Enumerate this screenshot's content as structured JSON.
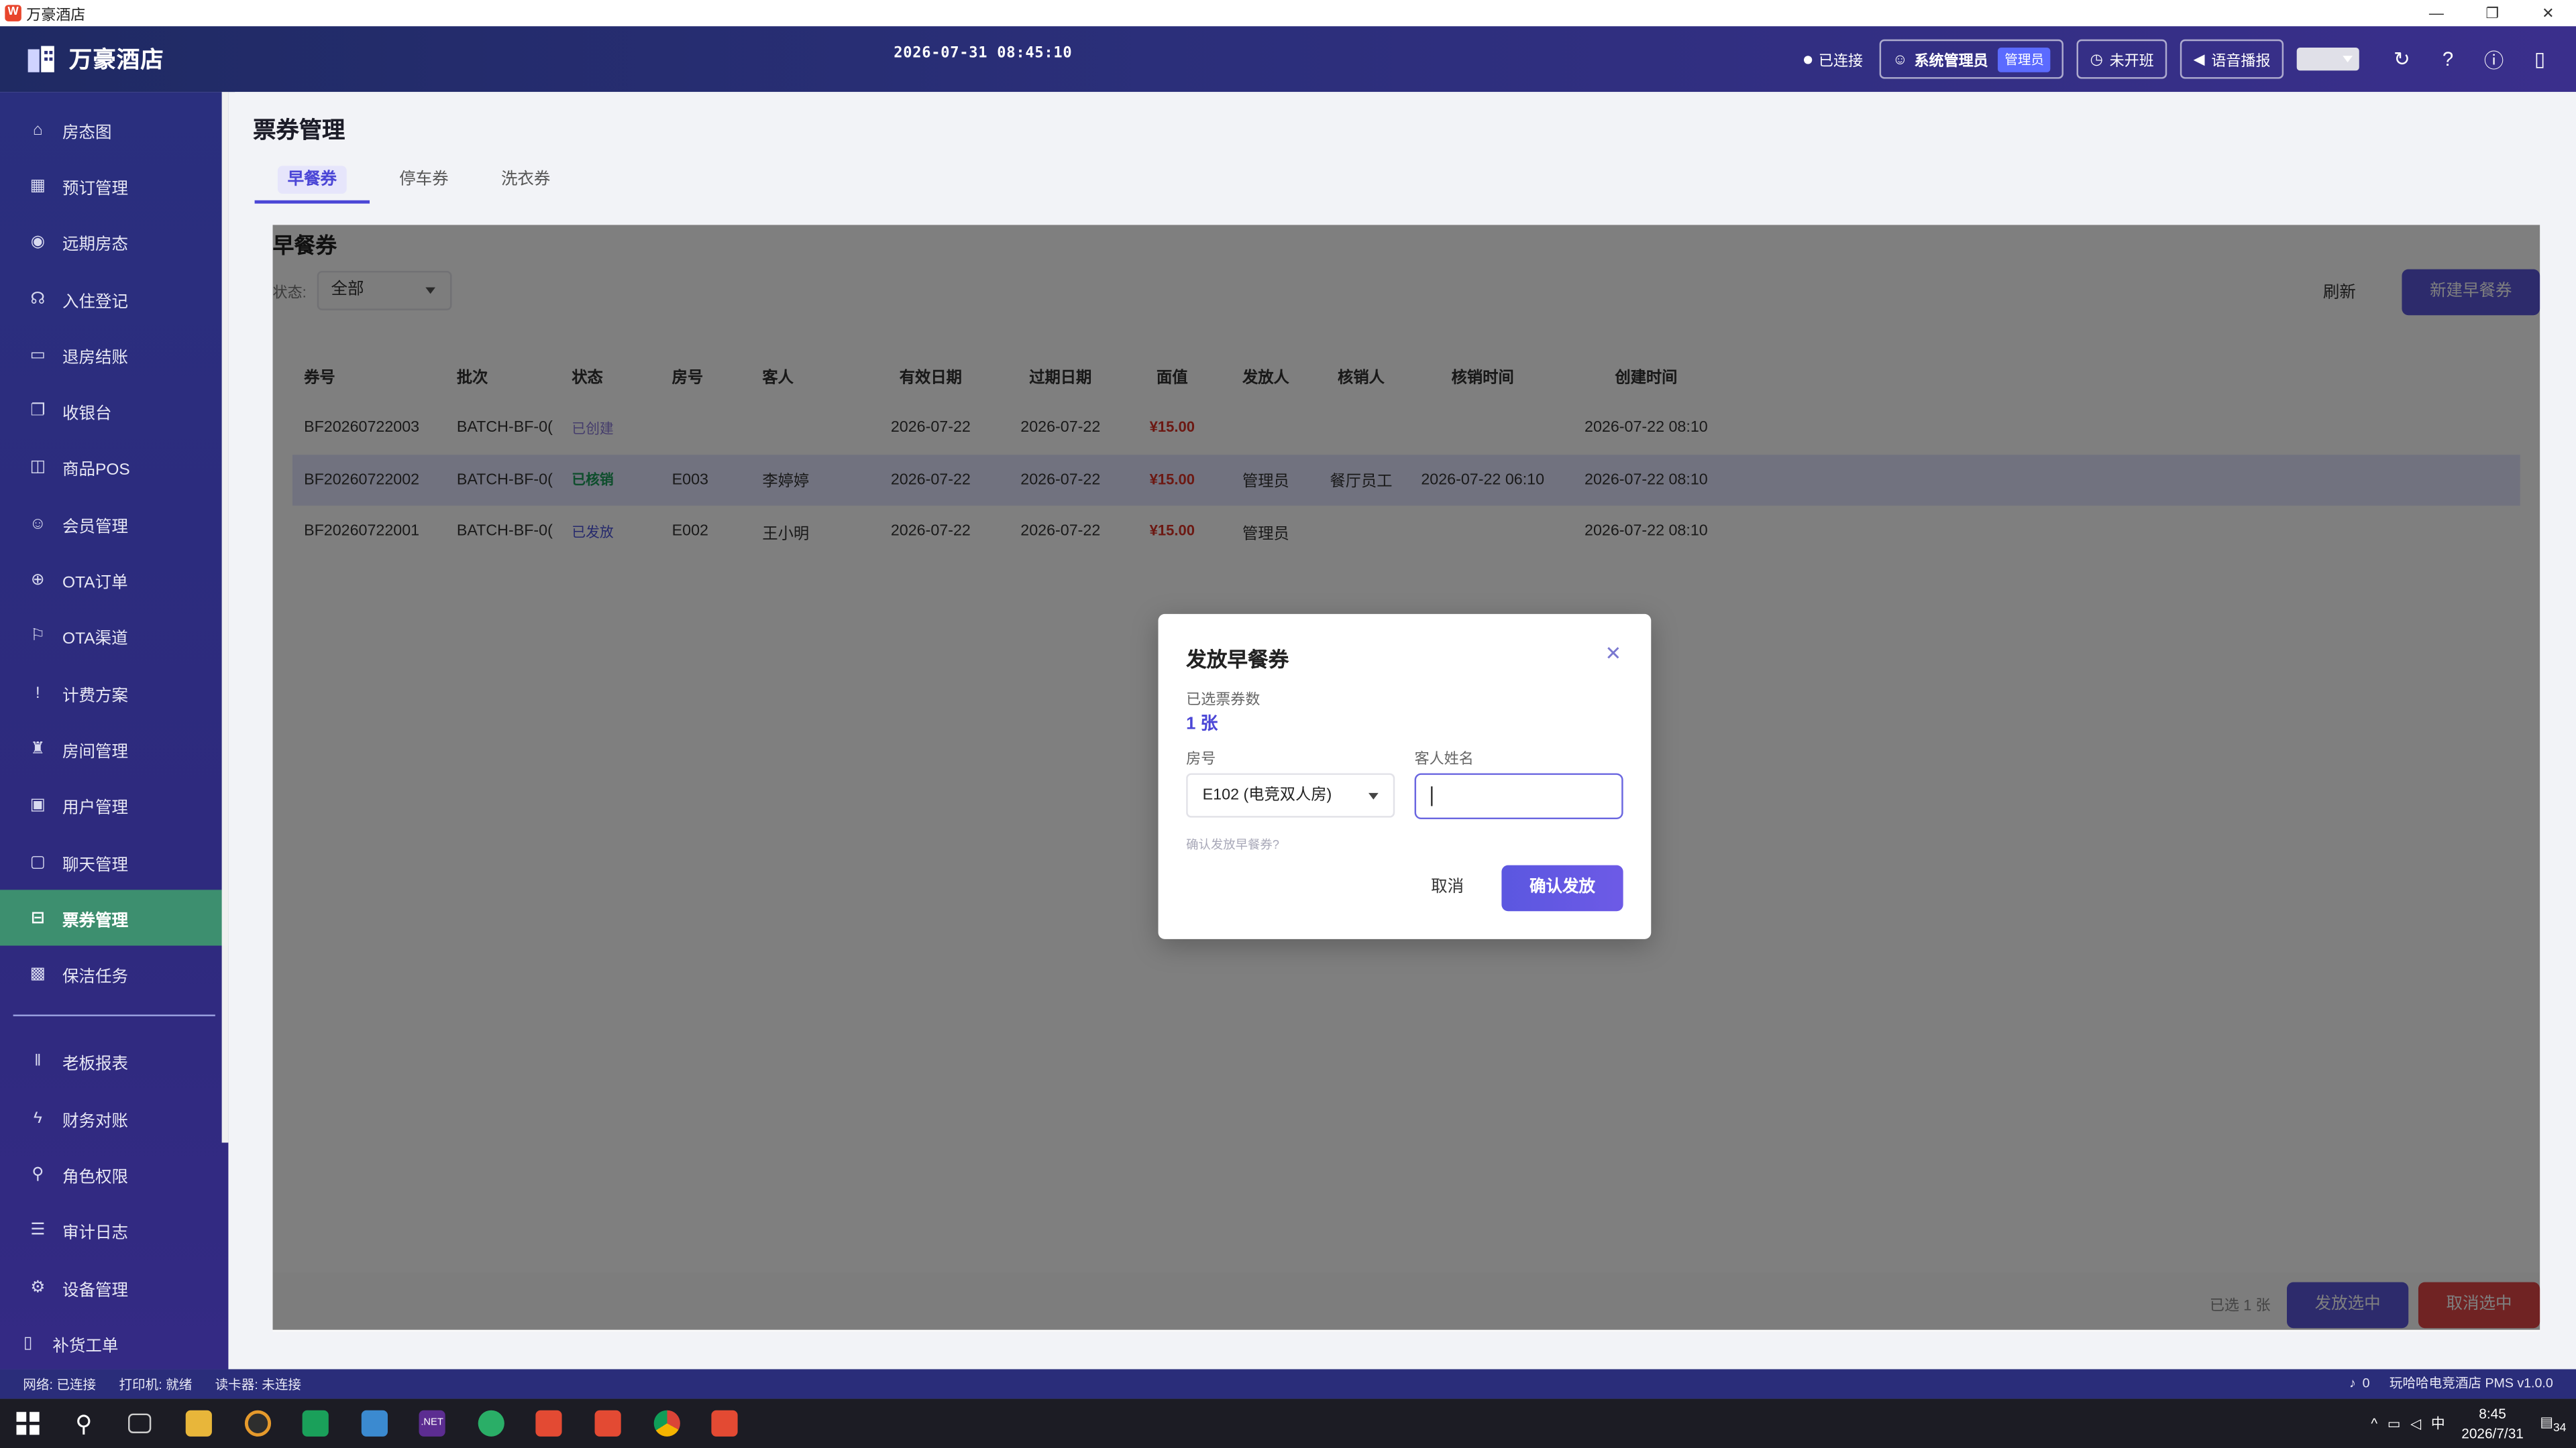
{
  "window": {
    "title": "万豪酒店"
  },
  "header": {
    "brand": "万豪酒店",
    "datetime": "2026-07-31 08:45:10",
    "connection": "已连接",
    "user_name": "系统管理员",
    "user_role": "管理员",
    "shift_btn": "未开班",
    "voice_btn": "语音播报"
  },
  "sidebar": {
    "items": [
      {
        "label": "房态图",
        "icon": "home-icon"
      },
      {
        "label": "预订管理",
        "icon": "calendar-icon"
      },
      {
        "label": "远期房态",
        "icon": "eye-icon"
      },
      {
        "label": "入住登记",
        "icon": "headset-icon"
      },
      {
        "label": "退房结账",
        "icon": "card-icon"
      },
      {
        "label": "收银台",
        "icon": "copy-icon"
      },
      {
        "label": "商品POS",
        "icon": "bag-icon"
      },
      {
        "label": "会员管理",
        "icon": "user-icon"
      },
      {
        "label": "OTA订单",
        "icon": "globe-icon"
      },
      {
        "label": "OTA渠道",
        "icon": "flag-icon"
      },
      {
        "label": "计费方案",
        "icon": "exclaim-icon"
      },
      {
        "label": "房间管理",
        "icon": "trophy-icon"
      },
      {
        "label": "用户管理",
        "icon": "monitor-icon"
      },
      {
        "label": "聊天管理",
        "icon": "chat-icon"
      },
      {
        "label": "票券管理",
        "icon": "ticket-icon"
      },
      {
        "label": "保洁任务",
        "icon": "chip-icon"
      },
      {
        "label": "老板报表",
        "icon": "bars-icon"
      },
      {
        "label": "财务对账",
        "icon": "bolt-icon"
      },
      {
        "label": "角色权限",
        "icon": "key-icon"
      },
      {
        "label": "审计日志",
        "icon": "list-icon"
      },
      {
        "label": "设备管理",
        "icon": "gear-icon"
      },
      {
        "label": "补货工单",
        "icon": "box-icon"
      }
    ]
  },
  "page": {
    "title": "票券管理",
    "tabs": [
      "早餐券",
      "停车券",
      "洗衣券"
    ],
    "panel_title": "早餐券",
    "filter_label": "状态:",
    "filter_value": "全部",
    "refresh": "刷新",
    "new_btn": "新建早餐券"
  },
  "table": {
    "headers": [
      "券号",
      "批次",
      "状态",
      "房号",
      "客人",
      "有效日期",
      "过期日期",
      "面值",
      "发放人",
      "核销人",
      "核销时间",
      "创建时间"
    ],
    "rows": [
      {
        "no": "BF20260722003",
        "batch": "BATCH-BF-0(",
        "status": "已创建",
        "room": "",
        "guest": "",
        "valid": "2026-07-22",
        "expire": "2026-07-22",
        "value": "¥15.00",
        "issuer": "",
        "redeemer": "",
        "redeem_time": "",
        "created": "2026-07-22 08:10"
      },
      {
        "no": "BF20260722002",
        "batch": "BATCH-BF-0(",
        "status": "已核销",
        "room": "E003",
        "guest": "李婷婷",
        "valid": "2026-07-22",
        "expire": "2026-07-22",
        "value": "¥15.00",
        "issuer": "管理员",
        "redeemer": "餐厅员工",
        "redeem_time": "2026-07-22 06:10",
        "created": "2026-07-22 08:10"
      },
      {
        "no": "BF20260722001",
        "batch": "BATCH-BF-0(",
        "status": "已发放",
        "room": "E002",
        "guest": "王小明",
        "valid": "2026-07-22",
        "expire": "2026-07-22",
        "value": "¥15.00",
        "issuer": "管理员",
        "redeemer": "",
        "redeem_time": "",
        "created": "2026-07-22 08:10"
      }
    ]
  },
  "footer": {
    "selected": "已选 1 张",
    "issue_btn": "发放选中",
    "cancel_btn": "取消选中"
  },
  "modal": {
    "title": "发放早餐券",
    "count_label": "已选票券数",
    "count_value": "1 张",
    "room_label": "房号",
    "room_value": "E102 (电竞双人房)",
    "guest_label": "客人姓名",
    "guest_value": "",
    "hint": "确认发放早餐券?",
    "cancel": "取消",
    "confirm": "确认发放"
  },
  "statusbar": {
    "network": "网络: 已连接",
    "printer": "打印机: 就绪",
    "card_reader": "读卡器: 未连接",
    "notifications": "0",
    "version": "玩哈哈电竞酒店 PMS v1.0.0"
  },
  "taskbar": {
    "time": "8:45",
    "date": "2026/7/31",
    "ime": "中",
    "notify_count": "34"
  },
  "colors": {
    "accent": "#4b46d6",
    "active_nav": "#3d8f6f",
    "price": "#d93025",
    "danger": "#e04747"
  }
}
